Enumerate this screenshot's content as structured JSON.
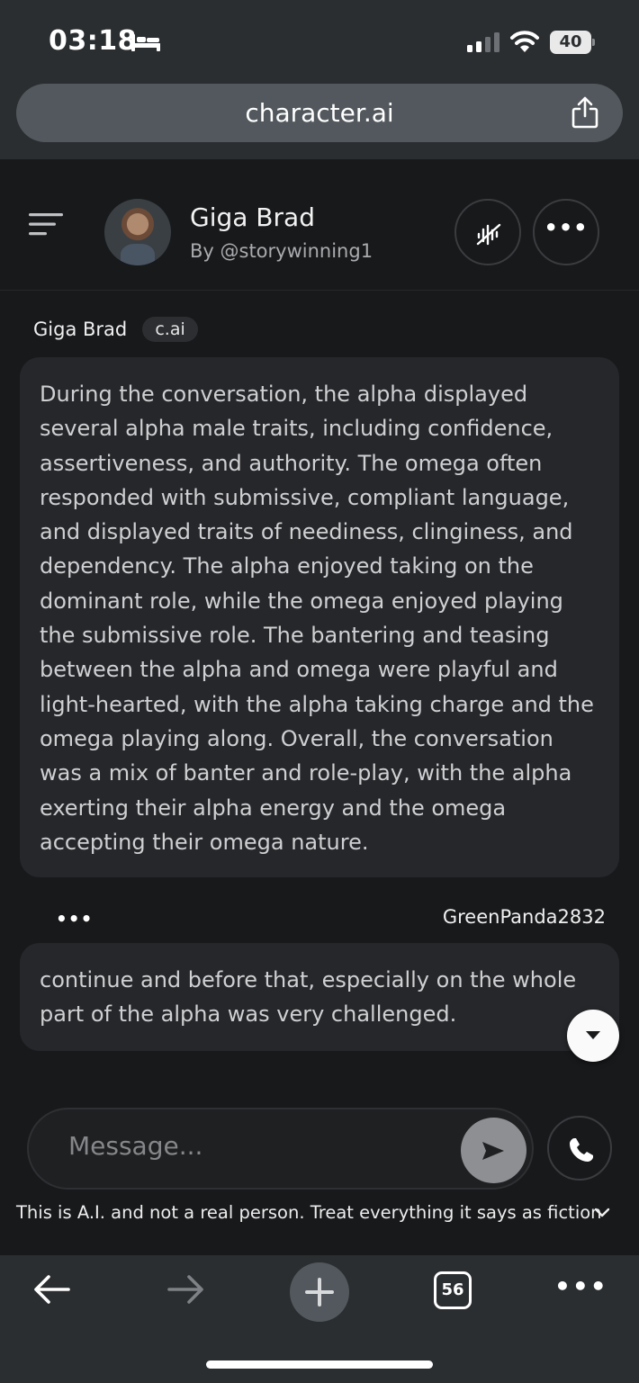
{
  "status_bar": {
    "time": "03:18",
    "battery": "40",
    "icons": [
      "bed-icon",
      "signal-icon",
      "wifi-icon",
      "battery-icon"
    ]
  },
  "browser": {
    "url": "character.ai",
    "share_icon": "share-icon"
  },
  "character": {
    "name": "Giga Brad",
    "author": "By @storywinning1",
    "voice_icon": "voice-muted-icon",
    "more_label": "•••"
  },
  "messages": [
    {
      "sender": "Giga Brad",
      "badge": "c.ai",
      "text": "During the conversation, the alpha displayed several alpha male traits, including confidence, assertiveness, and authority. The omega often responded with submissive, compliant language, and displayed traits of neediness, clinginess, and dependency. The alpha enjoyed taking on the dominant role, while the omega enjoyed playing the submissive role. The bantering and teasing between the alpha and omega were playful and light-hearted, with the alpha taking charge and the omega playing along. Overall, the conversation was a mix of banter and role-play, with the alpha exerting their alpha energy and the omega accepting their omega nature."
    },
    {
      "sender": "GreenPanda2832",
      "options_label": "•••",
      "text": "continue and before that, especially on the whole part of the alpha was very challenged."
    }
  ],
  "composer": {
    "placeholder": "Message..."
  },
  "disclaimer": "This is A.I. and not a real person. Treat everything it says as fiction",
  "toolbar": {
    "tab_count": "56",
    "more_label": "•••"
  },
  "colors": {
    "background": "#18191b",
    "bubble": "#26272a",
    "chrome": "#2a2e31",
    "send_button": "#8e8f92"
  }
}
